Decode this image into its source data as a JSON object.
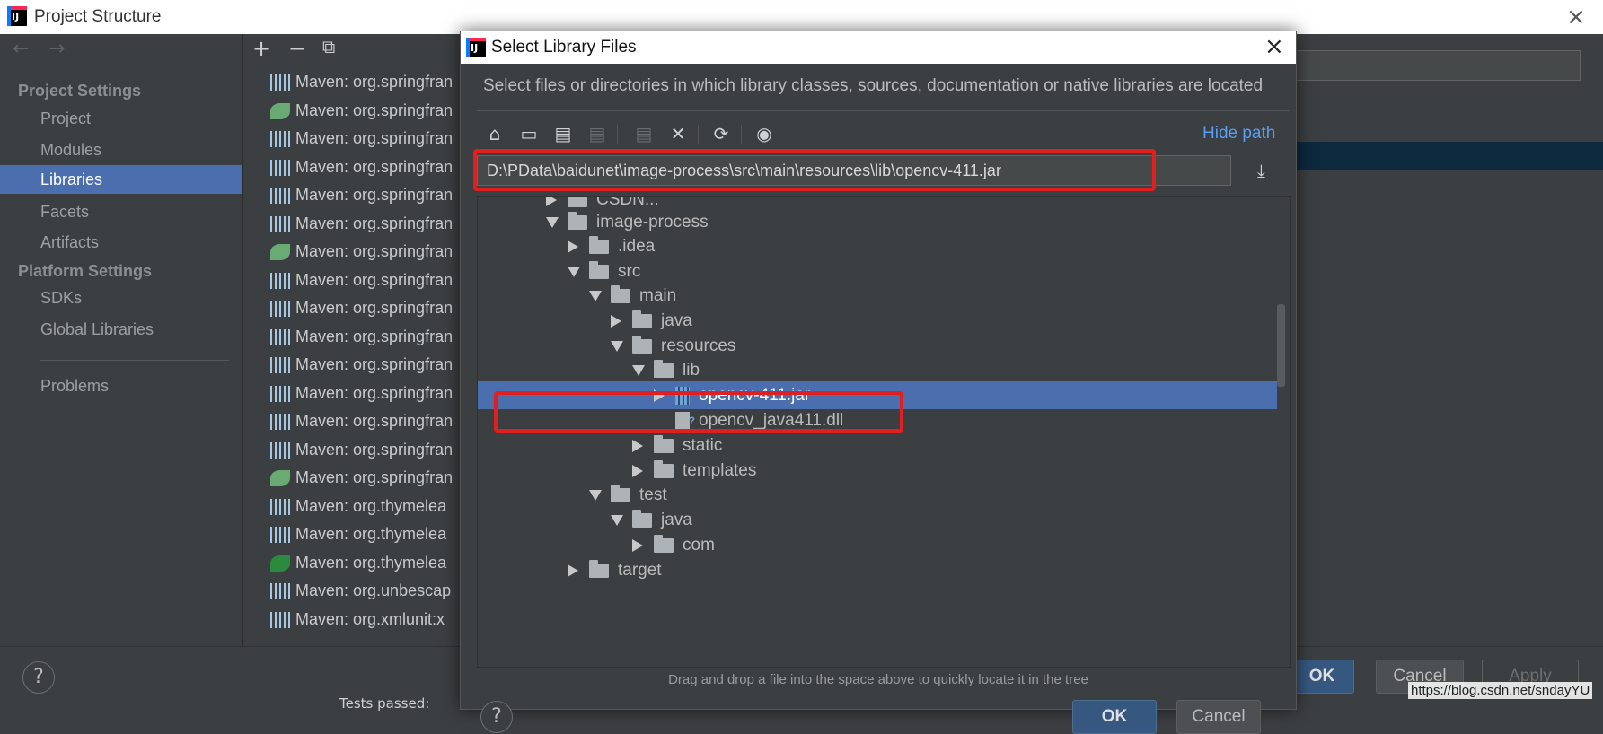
{
  "window": {
    "title": "Project Structure",
    "close_icon": "×"
  },
  "leftnav": {
    "back_icon": "←",
    "forward_icon": "→",
    "project_settings_header": "Project Settings",
    "project_settings_items": [
      "Project",
      "Modules",
      "Libraries",
      "Facets",
      "Artifacts"
    ],
    "selected": "Libraries",
    "platform_settings_header": "Platform Settings",
    "platform_settings_items": [
      "SDKs",
      "Global Libraries"
    ],
    "problems_label": "Problems"
  },
  "libraries": {
    "toolbar": {
      "add": "+",
      "remove": "−",
      "copy": "⧉"
    },
    "items": [
      {
        "label": "Maven: org.springfran",
        "icon": "maven-lib-icon"
      },
      {
        "label": "Maven: org.springfran",
        "icon": "spring-leaf-icon"
      },
      {
        "label": "Maven: org.springfran",
        "icon": "maven-lib-icon"
      },
      {
        "label": "Maven: org.springfran",
        "icon": "maven-lib-icon"
      },
      {
        "label": "Maven: org.springfran",
        "icon": "maven-lib-icon"
      },
      {
        "label": "Maven: org.springfran",
        "icon": "maven-lib-icon"
      },
      {
        "label": "Maven: org.springfran",
        "icon": "spring-leaf-icon"
      },
      {
        "label": "Maven: org.springfran",
        "icon": "maven-lib-icon"
      },
      {
        "label": "Maven: org.springfran",
        "icon": "maven-lib-icon"
      },
      {
        "label": "Maven: org.springfran",
        "icon": "maven-lib-icon"
      },
      {
        "label": "Maven: org.springfran",
        "icon": "maven-lib-icon"
      },
      {
        "label": "Maven: org.springfran",
        "icon": "maven-lib-icon"
      },
      {
        "label": "Maven: org.springfran",
        "icon": "maven-lib-icon"
      },
      {
        "label": "Maven: org.springfran",
        "icon": "maven-lib-icon"
      },
      {
        "label": "Maven: org.springfran",
        "icon": "spring-web-icon"
      },
      {
        "label": "Maven: org.thymelea",
        "icon": "maven-lib-icon"
      },
      {
        "label": "Maven: org.thymelea",
        "icon": "maven-lib-icon"
      },
      {
        "label": "Maven: org.thymelea",
        "icon": "thymeleaf-icon"
      },
      {
        "label": "Maven: org.unbescap",
        "icon": "maven-lib-icon"
      },
      {
        "label": "Maven: org.xmlunit:x",
        "icon": "maven-lib-icon"
      }
    ]
  },
  "dialog": {
    "title": "Select Library Files",
    "close_icon": "×",
    "description": "Select files or directories in which library classes, sources, documentation or native libraries are located",
    "hide_path_label": "Hide path",
    "path_value": "D:\\PData\\baidunet\\image-process\\src\\main\\resources\\lib\\opencv-411.jar",
    "toolbar_icons": [
      "home-icon",
      "desktop-icon",
      "project-folder-icon",
      "module-folder-icon",
      "new-folder-icon",
      "delete-icon",
      "refresh-icon",
      "show-hidden-icon"
    ],
    "tree": [
      {
        "label": "CSDN...",
        "depth": 2,
        "arrow": "r",
        "type": "folder",
        "partial": true
      },
      {
        "label": "image-process",
        "depth": 2,
        "arrow": "d",
        "type": "folder"
      },
      {
        "label": ".idea",
        "depth": 3,
        "arrow": "r",
        "type": "folder"
      },
      {
        "label": "src",
        "depth": 3,
        "arrow": "d",
        "type": "folder"
      },
      {
        "label": "main",
        "depth": 4,
        "arrow": "d",
        "type": "folder"
      },
      {
        "label": "java",
        "depth": 5,
        "arrow": "r",
        "type": "folder"
      },
      {
        "label": "resources",
        "depth": 5,
        "arrow": "d",
        "type": "folder"
      },
      {
        "label": "lib",
        "depth": 6,
        "arrow": "d",
        "type": "folder"
      },
      {
        "label": "opencv-411.jar",
        "depth": 7,
        "arrow": "r",
        "type": "jar",
        "selected": true
      },
      {
        "label": "opencv_java411.dll",
        "depth": 7,
        "arrow": "",
        "type": "dll"
      },
      {
        "label": "static",
        "depth": 6,
        "arrow": "r",
        "type": "folder"
      },
      {
        "label": "templates",
        "depth": 6,
        "arrow": "r",
        "type": "folder"
      },
      {
        "label": "test",
        "depth": 4,
        "arrow": "d",
        "type": "folder"
      },
      {
        "label": "java",
        "depth": 5,
        "arrow": "d",
        "type": "folder"
      },
      {
        "label": "com",
        "depth": 6,
        "arrow": "r",
        "type": "folder"
      },
      {
        "label": "target",
        "depth": 3,
        "arrow": "r",
        "type": "folder"
      }
    ],
    "hint": "Drag and drop a file into the space above to quickly locate it in the tree",
    "ok_label": "OK",
    "cancel_label": "Cancel",
    "help_label": "?"
  },
  "footer": {
    "help_label": "?",
    "ok_label": "OK",
    "cancel_label": "Cancel",
    "apply_label": "Apply",
    "status_text": "Tests passed: "
  },
  "watermark": "https://blog.csdn.net/sndayYU",
  "colors": {
    "selection": "#4b6eaf",
    "highlight_box": "#e02020",
    "link": "#589df6"
  }
}
